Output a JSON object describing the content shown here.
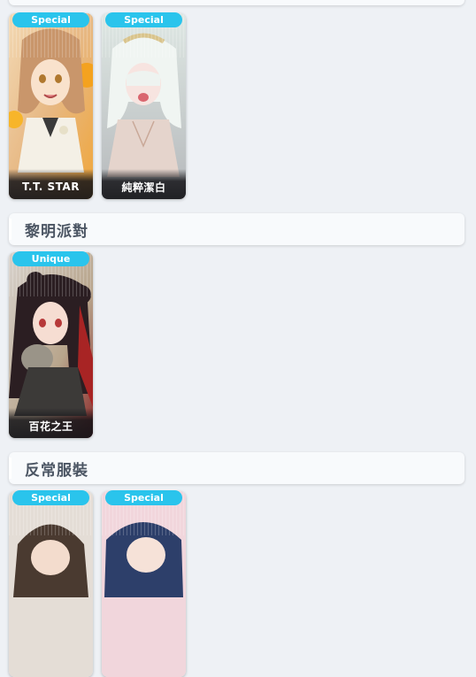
{
  "sections": [
    {
      "title": "",
      "cards": [
        {
          "badge": "Special",
          "name": "T.T. STAR",
          "theme": "gold"
        },
        {
          "badge": "Special",
          "name": "純粹潔白",
          "theme": "white"
        }
      ]
    },
    {
      "title": "黎明派對",
      "cards": [
        {
          "badge": "Unique",
          "name": "百花之王",
          "theme": "dark"
        }
      ]
    },
    {
      "title": "反常服裝",
      "cards": [
        {
          "badge": "Special",
          "name": "",
          "theme": "brown"
        },
        {
          "badge": "Special",
          "name": "",
          "theme": "blue"
        }
      ]
    }
  ],
  "colors": {
    "badge": "#2ac4ec",
    "header_bg": "#f8fafc",
    "page_bg": "#eef1f5",
    "title_text": "#4b5563"
  }
}
